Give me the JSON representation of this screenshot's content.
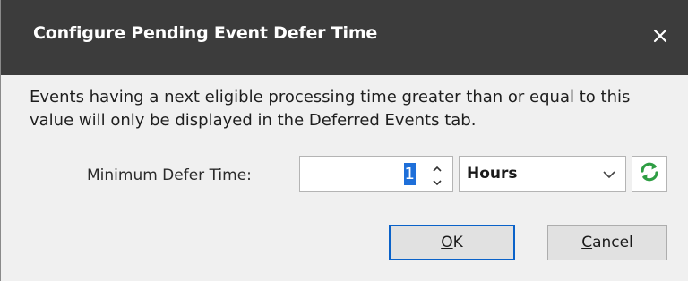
{
  "dialog": {
    "title": "Configure Pending Event Defer Time",
    "close_icon": "close-icon",
    "description": "Events having a next eligible processing time greater than or equal to this value will only be displayed in the Deferred Events tab."
  },
  "defer": {
    "label": "Minimum Defer Time:",
    "value": "1",
    "unit": "Hours",
    "refresh_icon": "refresh-icon",
    "refresh_color": "#2f9e44"
  },
  "buttons": {
    "ok_mnemonic": "O",
    "ok_rest": "K",
    "cancel_mnemonic": "C",
    "cancel_rest": "ancel"
  },
  "colors": {
    "titlebar": "#3c3c3c",
    "accent": "#0a62c9",
    "selection": "#1e6fd9"
  }
}
